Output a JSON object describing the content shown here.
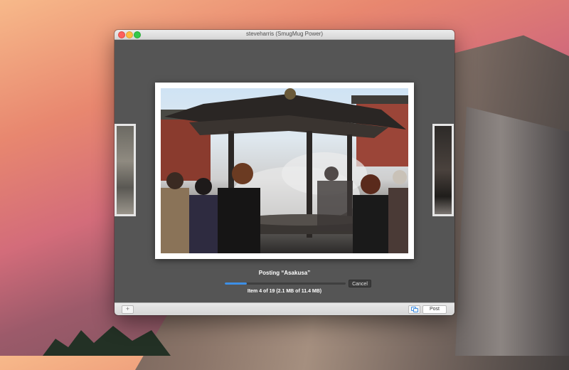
{
  "window": {
    "title": "steveharris (SmugMug Power)"
  },
  "upload": {
    "status_title": "Posting “Asakusa”",
    "progress_fraction": 0.18,
    "cancel_label": "Cancel",
    "detail": "Item 4 of 19 (2.1 MB of 11.4 MB)"
  },
  "toolbar": {
    "add_label": "+",
    "post_label": "Post"
  },
  "colors": {
    "progress": "#3d8fe6"
  }
}
